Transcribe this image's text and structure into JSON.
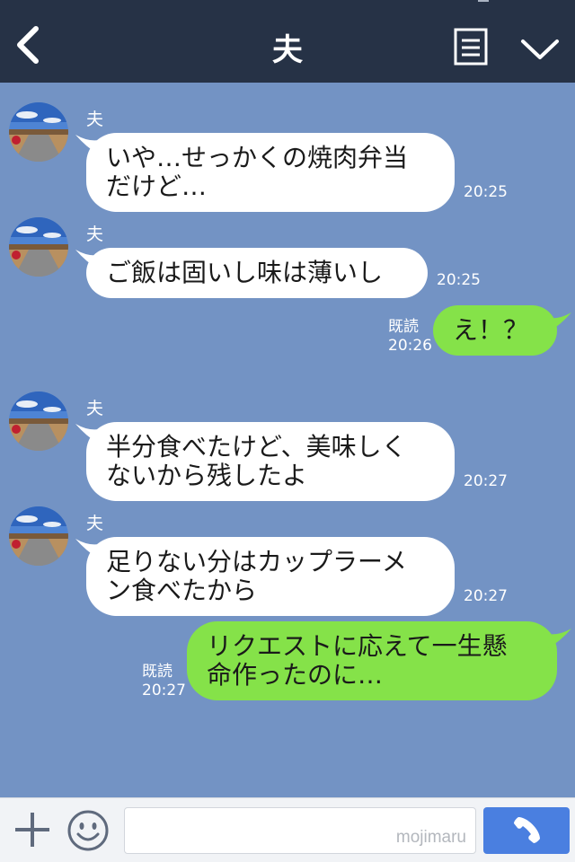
{
  "header": {
    "title": "夫",
    "icons": {
      "back": "chevron-left-icon",
      "menu": "note-icon",
      "expand": "chevron-down-icon"
    }
  },
  "messages": [
    {
      "from": "夫",
      "direction": "incoming",
      "text": "いや…せっかくの焼肉弁当\nだけど…",
      "time": "20:25"
    },
    {
      "from": "夫",
      "direction": "incoming",
      "text": "ご飯は固いし味は薄いし",
      "time": "20:25"
    },
    {
      "direction": "outgoing",
      "text": "え！？",
      "read": "既読",
      "time": "20:26"
    },
    {
      "from": "夫",
      "direction": "incoming",
      "text": "半分食べたけど、美味しく\nないから残したよ",
      "time": "20:27"
    },
    {
      "from": "夫",
      "direction": "incoming",
      "text": "足りない分はカップラーメ\nン食べたから",
      "time": "20:27"
    },
    {
      "direction": "outgoing",
      "text": "リクエストに応えて一生懸\n命作ったのに…",
      "read": "既読",
      "time": "20:27"
    }
  ],
  "footer": {
    "input_value": "",
    "watermark": "mojimaru",
    "icons": {
      "add": "plus-icon",
      "sticker": "smile-icon",
      "call": "phone-icon"
    }
  },
  "colors": {
    "header_bg": "#263246",
    "chat_bg": "#7393c4",
    "incoming_bubble": "#ffffff",
    "outgoing_bubble": "#85e249",
    "call_button": "#4a7fe0"
  }
}
